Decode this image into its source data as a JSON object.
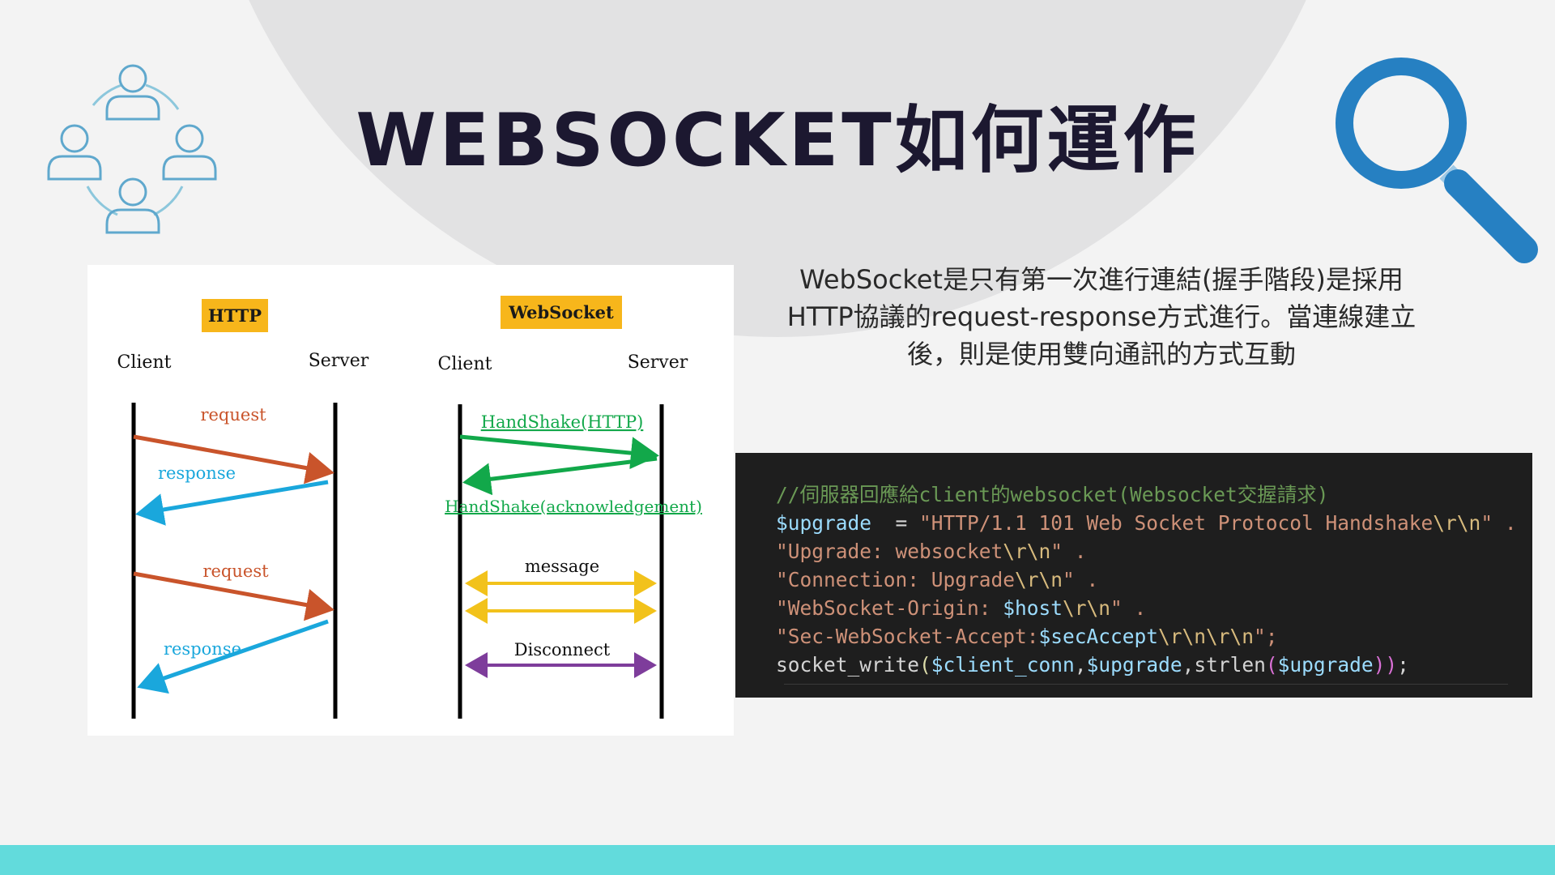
{
  "slide": {
    "title": "WEBSOCKET如何運作",
    "description": "WebSocket是只有第一次進行連結(握手階段)是採用HTTP協議的request-response方式進行。當連線建立後，則是使用雙向通訊的方式互動"
  },
  "diagram": {
    "http_label": "HTTP",
    "websocket_label": "WebSocket",
    "http_client": "Client",
    "http_server": "Server",
    "ws_client": "Client",
    "ws_server": "Server",
    "request_1": "request",
    "response_1": "response",
    "request_2": "request",
    "response_2": "response",
    "handshake_http": "HandShake(HTTP)",
    "handshake_ack": "HandShake(acknowledgement)",
    "message": "message",
    "disconnect": "Disconnect"
  },
  "code": {
    "comment": "//伺服器回應給client的websocket(Websocket交握請求)",
    "l1_var": "$upgrade",
    "l1_eq": "  = ",
    "l1_str_a": "\"HTTP/1.1 101 Web Socket Protocol Handshake",
    "l1_esc": "\\r\\n",
    "l1_end": "\" .",
    "l2_str": "\"Upgrade: websocket",
    "l2_esc": "\\r\\n",
    "l2_end": "\" .",
    "l3_str": "\"Connection: Upgrade",
    "l3_esc": "\\r\\n",
    "l3_end": "\" .",
    "l4_str": "\"WebSocket-Origin: ",
    "l4_var": "$host",
    "l4_esc": "\\r\\n",
    "l4_end": "\" .",
    "l5_str": "\"Sec-WebSocket-Accept:",
    "l5_var": "$secAccept",
    "l5_esc": "\\r\\n\\r\\n",
    "l5_end": "\";",
    "l6_fn": "socket_write",
    "l6_open": "(",
    "l6_var1": "$client_conn",
    "l6_comma1": ",",
    "l6_var2": "$upgrade",
    "l6_comma2": ",",
    "l6_fn2": "strlen",
    "l6_open2": "(",
    "l6_var3": "$upgrade",
    "l6_close": "))",
    "l6_semi": ";"
  },
  "colors": {
    "request": "#c9542b",
    "response": "#1aa7dc",
    "handshake": "#12a84a",
    "message": "#f2c21b",
    "disconnect": "#7e3d9b",
    "label_bg": "#f7b61b",
    "accent_blue": "#2680c2",
    "bottom_bar": "#62dbdc"
  }
}
